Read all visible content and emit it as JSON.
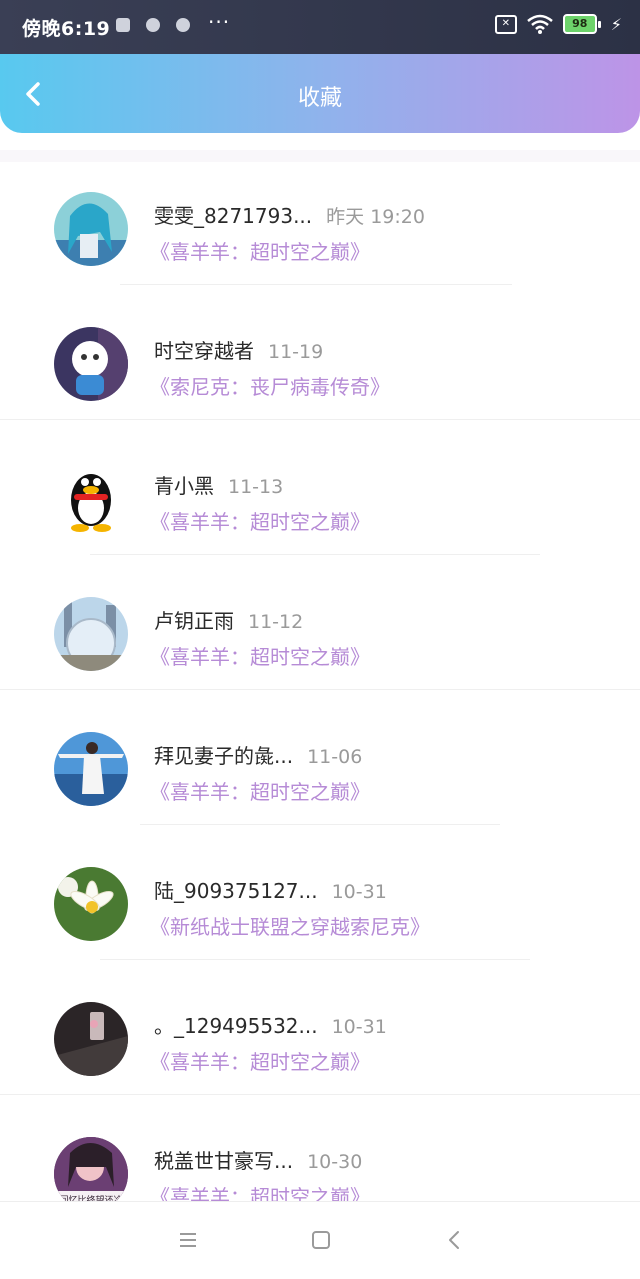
{
  "status_bar": {
    "time": "傍晚6:19",
    "more": "···",
    "sim_icon": "sim-disabled-icon",
    "wifi_icon": "wifi-icon",
    "battery_level": "98",
    "charging_icon": "charging-bolt-icon"
  },
  "header": {
    "title": "收藏",
    "back_icon": "chevron-left-icon"
  },
  "favorites": [
    {
      "name": "雯雯_8271793...",
      "date": "昨天 19:20",
      "work": "《喜羊羊：超时空之巅》"
    },
    {
      "name": "时空穿越者",
      "date": "11-19",
      "work": "《索尼克：丧尸病毒传奇》"
    },
    {
      "name": "青小黑",
      "date": "11-13",
      "work": "《喜羊羊：超时空之巅》"
    },
    {
      "name": "卢钥正雨",
      "date": "11-12",
      "work": "《喜羊羊：超时空之巅》"
    },
    {
      "name": "拜见妻子的彘...",
      "date": "11-06",
      "work": "《喜羊羊：超时空之巅》"
    },
    {
      "name": "陆_909375127...",
      "date": "10-31",
      "work": "《新纸战士联盟之穿越索尼克》"
    },
    {
      "name": "。_129495532...",
      "date": "10-31",
      "work": "《喜羊羊：超时空之巅》"
    },
    {
      "name": "税盖世甘豪写...",
      "date": "10-30",
      "work": "《喜羊羊：超时空之巅》"
    }
  ],
  "avatar_texts": {
    "item8_caption": "回忆比终望还冷"
  },
  "colors": {
    "header_gradient_start": "#58c9ef",
    "header_gradient_end": "#bd94e7",
    "work_title": "#b68bd6",
    "date": "#9a9a9a"
  },
  "nav": {
    "menu_icon": "menu-icon",
    "home_icon": "home-square-icon",
    "back_icon": "back-triangle-icon"
  }
}
